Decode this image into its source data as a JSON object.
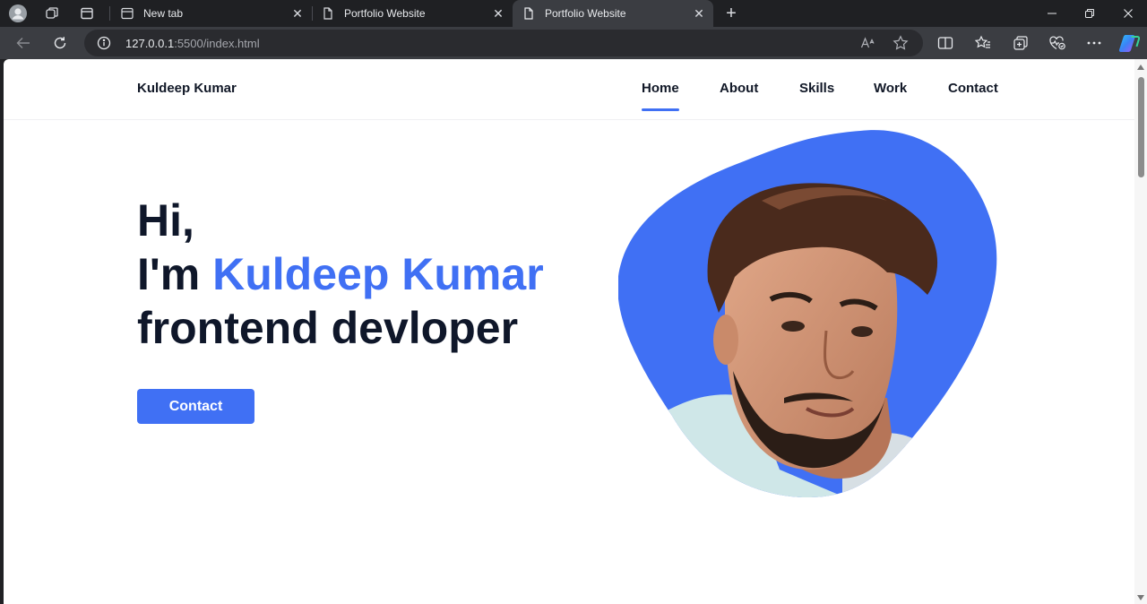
{
  "browser": {
    "tabs": [
      {
        "title": "New tab",
        "active": false
      },
      {
        "title": "Portfolio Website",
        "active": false
      },
      {
        "title": "Portfolio Website",
        "active": true
      }
    ],
    "url_host": "127.0.0.1",
    "url_rest": ":5500/index.html",
    "close_glyph": "✕",
    "new_tab_glyph": "+"
  },
  "site": {
    "logo": "Kuldeep Kumar",
    "nav": [
      "Home",
      "About",
      "Skills",
      "Work",
      "Contact"
    ],
    "active_nav": "Home",
    "hero": {
      "line1": "Hi,",
      "line2_prefix": "I'm ",
      "line2_name": "Kuldeep Kumar",
      "line3": "frontend devloper"
    },
    "cta_label": "Contact"
  },
  "colors": {
    "accent": "#4070f4",
    "heading": "#0f172a",
    "chrome_dark": "#1f2023",
    "chrome_toolbar": "#3b3d42"
  },
  "icons": {
    "profile": "avatar-icon",
    "workspaces": "workspaces-icon",
    "tab_actions": "tab-actions-icon",
    "back": "back-arrow-icon",
    "refresh": "refresh-icon",
    "info": "info-icon",
    "read_aloud": "read-aloud-icon",
    "favorite": "star-icon",
    "split": "split-screen-icon",
    "favorites": "favorites-icon",
    "collections": "collections-icon",
    "browser_essentials": "heart-pulse-icon",
    "more": "more-icon",
    "copilot": "copilot-icon"
  }
}
